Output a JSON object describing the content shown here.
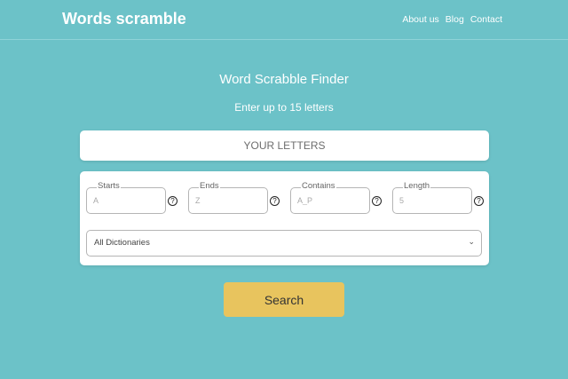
{
  "header": {
    "brand": "Words scramble",
    "nav": [
      "About us",
      "Blog",
      "Contact"
    ]
  },
  "hero": {
    "title": "Word Scrabble Finder",
    "subtitle": "Enter up to 15 letters"
  },
  "letters_input": {
    "placeholder": "YOUR LETTERS",
    "value": ""
  },
  "filters": {
    "starts": {
      "label": "Starts",
      "placeholder": "A"
    },
    "ends": {
      "label": "Ends",
      "placeholder": "Z"
    },
    "contains": {
      "label": "Contains",
      "placeholder": "A_P"
    },
    "length": {
      "label": "Length",
      "placeholder": "5"
    },
    "help_glyph": "?"
  },
  "dictionary": {
    "selected": "All Dictionaries"
  },
  "search_button": {
    "label": "Search"
  },
  "colors": {
    "background": "#6cc2c8",
    "button": "#e8c45e",
    "card": "#ffffff"
  }
}
